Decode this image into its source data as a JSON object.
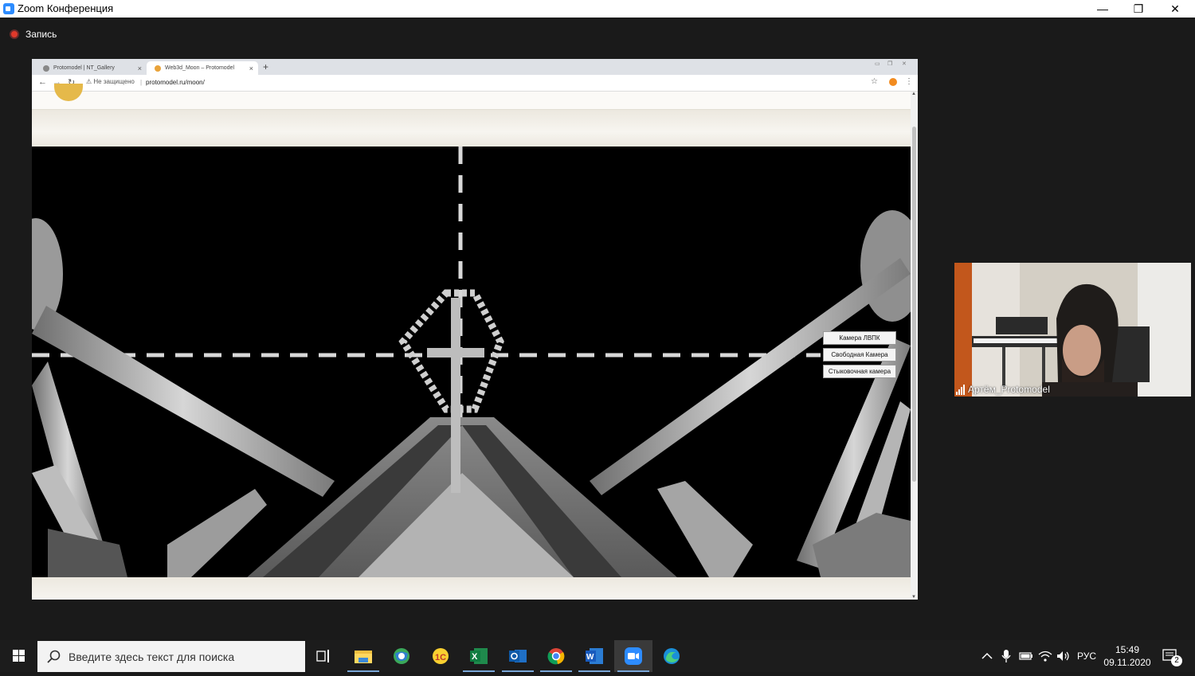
{
  "window": {
    "title": "Zoom Конференция",
    "controls": {
      "minimize": "—",
      "restore": "❐",
      "close": "✕"
    }
  },
  "zoom": {
    "recording_label": "Запись"
  },
  "browser": {
    "tabs": [
      {
        "label": "Protomodel | NT_Gallery",
        "close": "×",
        "active": false
      },
      {
        "label": "Web3d_Moon – Protomodel",
        "close": "×",
        "active": true
      }
    ],
    "new_tab": "+",
    "nav": {
      "back": "←",
      "forward": "→",
      "reload": "↻"
    },
    "security_label": "Не защищено",
    "url": "protomodel.ru/moon/",
    "star": "☆",
    "menu": "⋮"
  },
  "scene": {
    "camera_buttons": [
      "Камера ЛВПК",
      "Свободная Камера",
      "Стыковочная камера"
    ]
  },
  "participant": {
    "name": "Артём_Protomodel"
  },
  "taskbar": {
    "search_placeholder": "Введите здесь текст для поиска",
    "apps": [
      "task-view",
      "file-explorer",
      "maps",
      "1c",
      "excel",
      "outlook",
      "chrome",
      "word",
      "zoom",
      "edge"
    ],
    "language": "РУС",
    "time": "15:49",
    "date": "09.11.2020",
    "notifications": "2"
  },
  "colors": {
    "zoom_blue": "#2d8cff",
    "record_red": "#e0392b",
    "taskbar": "#1c1c1c"
  }
}
